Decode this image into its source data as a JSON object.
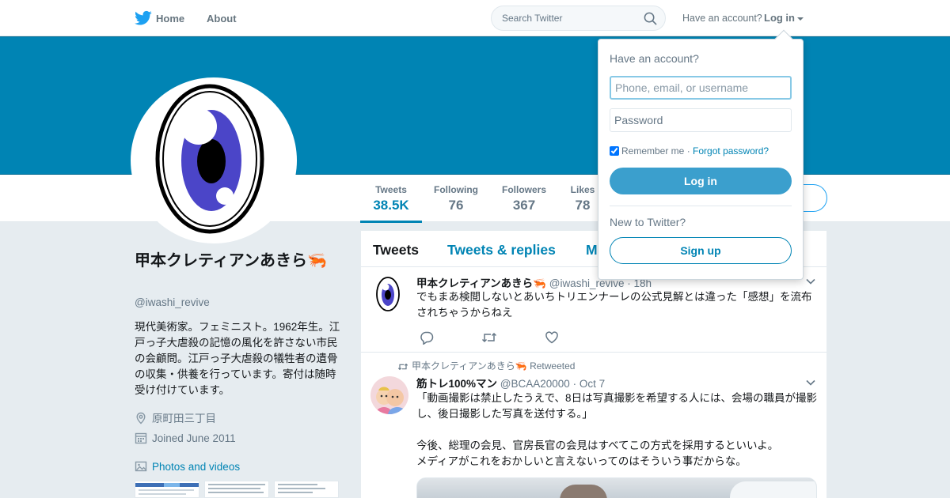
{
  "nav": {
    "home_label": "Home",
    "about_label": "About",
    "search_placeholder": "Search Twitter",
    "have_account": "Have an account?",
    "login_label": "Log in"
  },
  "profile": {
    "name": "甲本クレティアンあきら🦐",
    "handle": "@iwashi_revive",
    "bio": "現代美術家。フェミニスト。1962年生。江戸っ子大虐殺の記憶の風化を許さない市民の会顧問。江戸っ子大虐殺の犠牲者の遺骨の収集・供養を行っています。寄付は随時受け付けています。",
    "location": "原町田三丁目",
    "joined": "Joined June 2011",
    "photos_label": "Photos and videos"
  },
  "stats": [
    {
      "label": "Tweets",
      "value": "38.5K"
    },
    {
      "label": "Following",
      "value": "76"
    },
    {
      "label": "Followers",
      "value": "367"
    },
    {
      "label": "Likes",
      "value": "78"
    }
  ],
  "timeline": {
    "tabs": [
      "Tweets",
      "Tweets & replies",
      "M"
    ],
    "tweets": [
      {
        "name": "甲本クレティアンあきら🦐",
        "handle": "@iwashi_revive",
        "time": "18h",
        "text": "でもまあ検閲しないとあいちトリエンナーレの公式見解とは違った「感想」を流布されちゃうからねえ"
      },
      {
        "retweeted_by": "甲本クレティアンあきら🦐 Retweeted",
        "name": "筋トレ100%マン",
        "handle": "@BCAA20000",
        "time": "Oct 7",
        "text": "「動画撮影は禁止したうえで、8日は写真撮影を希望する人には、会場の職員が撮影し、後日撮影した写真を送付する。」\n\n今後、総理の会見、官房長官の会見はすべてこの方式を採用するといいよ。\nメディアがこれをおかしいと言えないってのはそういう事だからな。"
      }
    ]
  },
  "login_dropdown": {
    "title": "Have an account?",
    "username_placeholder": "Phone, email, or username",
    "password_placeholder": "Password",
    "remember_label": "Remember me",
    "separator": "·",
    "forgot_label": "Forgot password?",
    "login_button": "Log in",
    "new_to_twitter": "New to Twitter?",
    "signup_button": "Sign up"
  },
  "colors": {
    "brand": "#1da1f2",
    "banner": "#0084b4",
    "link": "#0084b4",
    "login_button": "#3b9fcd"
  }
}
